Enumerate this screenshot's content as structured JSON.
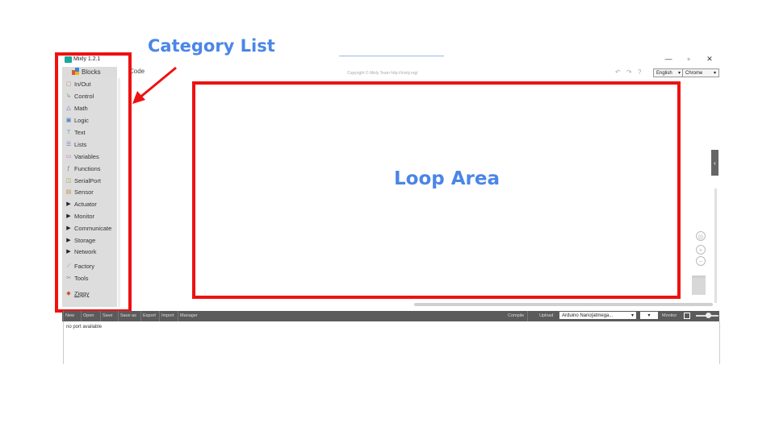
{
  "annotations": {
    "category_list": "Category List",
    "loop_area": "Loop Area"
  },
  "window": {
    "title": "Mixly 1.2.1",
    "minimize": "—",
    "maximize": "▫",
    "close": "✕"
  },
  "sidebar": {
    "tab_label": "Blocks",
    "items": [
      {
        "label": "In/Out",
        "icon": "inout-icon",
        "glyph": "▢",
        "color": "#d08060"
      },
      {
        "label": "Control",
        "icon": "control-icon",
        "glyph": "↳",
        "color": "#5aaa5a"
      },
      {
        "label": "Math",
        "icon": "math-icon",
        "glyph": "△",
        "color": "#6060c0"
      },
      {
        "label": "Logic",
        "icon": "logic-icon",
        "glyph": "▣",
        "color": "#4f7fc0"
      },
      {
        "label": "Text",
        "icon": "text-icon",
        "glyph": "T",
        "color": "#58a8a8"
      },
      {
        "label": "Lists",
        "icon": "lists-icon",
        "glyph": "☰",
        "color": "#7070c0"
      },
      {
        "label": "Variables",
        "icon": "variables-icon",
        "glyph": "▭",
        "color": "#c06aa8"
      },
      {
        "label": "Functions",
        "icon": "functions-icon",
        "glyph": "ƒ",
        "color": "#a060b0"
      },
      {
        "label": "SerialPort",
        "icon": "serialport-icon",
        "glyph": "◫",
        "color": "#a8a040"
      },
      {
        "label": "Sensor",
        "icon": "sensor-icon",
        "glyph": "▤",
        "color": "#c09040"
      },
      {
        "label": "Actuator",
        "icon": "arrow-right-icon",
        "glyph": "▶",
        "color": "#222"
      },
      {
        "label": "Monitor",
        "icon": "arrow-right-icon",
        "glyph": "▶",
        "color": "#222"
      },
      {
        "label": "Communicate",
        "icon": "arrow-right-icon",
        "glyph": "▶",
        "color": "#222"
      },
      {
        "label": "Storage",
        "icon": "arrow-right-icon",
        "glyph": "▶",
        "color": "#222"
      },
      {
        "label": "Network",
        "icon": "arrow-right-icon",
        "glyph": "▶",
        "color": "#222"
      },
      {
        "label": "Factory",
        "icon": "factory-icon",
        "glyph": "⟋",
        "color": "#888"
      },
      {
        "label": "Tools",
        "icon": "tools-icon",
        "glyph": "✂",
        "color": "#888"
      },
      {
        "label": "Ziggy",
        "icon": "ziggy-icon",
        "glyph": "◆",
        "color": "#d05030"
      }
    ]
  },
  "editor": {
    "code_tab": "Code",
    "copyright": "Copyright © Mixly Team http://mixly.org/",
    "language": "English",
    "browser": "Chrome"
  },
  "toolbar": {
    "buttons": [
      "New",
      "Open",
      "Save",
      "Save as",
      "Export",
      "Import",
      "Manager"
    ],
    "compile": "Compile",
    "upload": "Upload",
    "board": "Arduino Nano[atmega...",
    "monitor": "Monitor"
  },
  "console": {
    "text": "no port available"
  }
}
